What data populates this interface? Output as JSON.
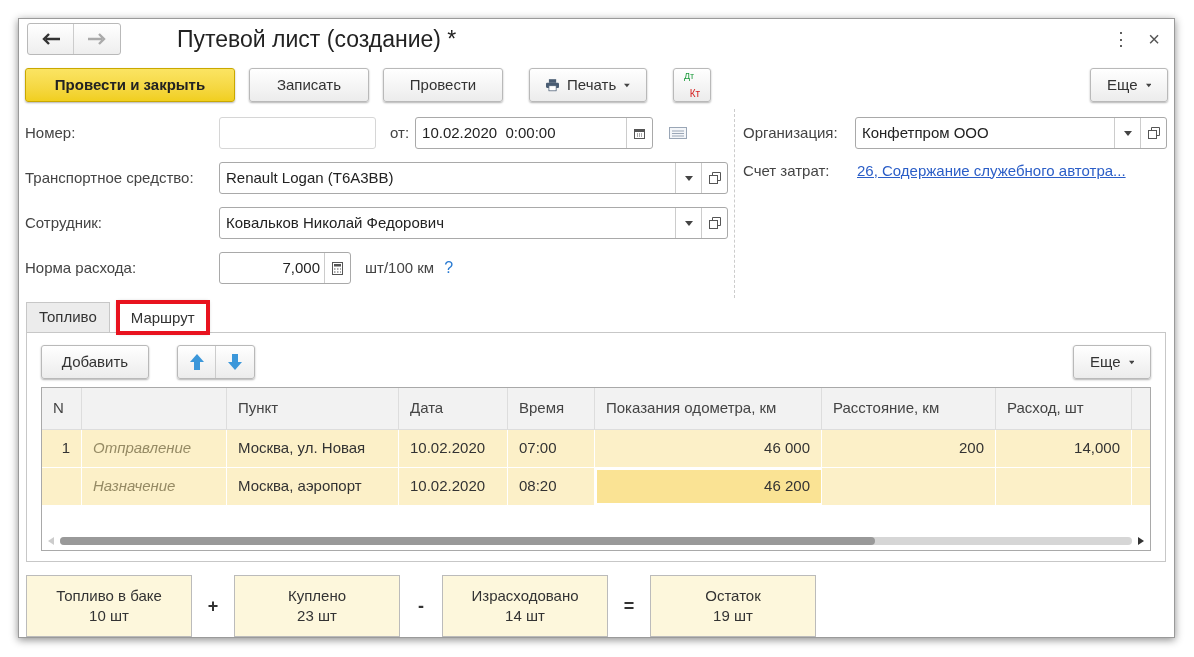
{
  "window": {
    "title": "Путевой лист (создание) *",
    "menu_icon": "⋮",
    "close": "×"
  },
  "toolbar": {
    "buttons": [
      {
        "kind": "primary",
        "label": "Провести и закрыть"
      },
      {
        "kind": "plain",
        "label": "Записать"
      },
      {
        "kind": "plain",
        "label": "Провести"
      },
      {
        "kind": "menu",
        "label": "Печать"
      },
      {
        "kind": "dtkt",
        "top": "Дт",
        "bottom": "Кт"
      }
    ],
    "more": "Еще"
  },
  "number": {
    "label": "Номер:"
  },
  "date": {
    "label": "от:",
    "value": "10.02.2020  0:00:00"
  },
  "vehicle": {
    "label": "Транспортное средство:",
    "value": "Renault Logan (Т6А3ВВ)"
  },
  "employee": {
    "label": "Сотрудник:",
    "value": "Ковальков Николай Федорович"
  },
  "norm": {
    "label": "Норма расхода:",
    "value": "7,000",
    "unit": "шт/100 км",
    "help": "?"
  },
  "organization": {
    "label": "Организация:",
    "value": "Конфетпром ООО"
  },
  "cost_account": {
    "label": "Счет затрат:",
    "value": "26, Содержание служебного автотра..."
  },
  "tabs": [
    {
      "label": "Топливо",
      "selected": false,
      "highlighted": false
    },
    {
      "label": "Маршрут",
      "selected": true,
      "highlighted": true
    }
  ],
  "table": {
    "add": "Добавить",
    "more": "Еще",
    "columns": [
      {
        "label": "N"
      },
      {},
      {
        "label": "Пункт"
      },
      {
        "label": "Дата"
      },
      {
        "label": "Время"
      },
      {
        "label": "Показания одометра, км"
      },
      {
        "label": "Расстояние, км"
      },
      {
        "label": "Расход, шт"
      }
    ],
    "rows": [
      {
        "n": "1",
        "type": "Отправление",
        "point": "Москва, ул. Новая",
        "date": "10.02.2020",
        "time": "07:00",
        "odometer": "46 000",
        "distance": "200",
        "consumption": "14,000",
        "selected": true,
        "odometer_focused": false
      },
      {
        "type": "Назначение",
        "point": "Москва, аэропорт",
        "date": "10.02.2020",
        "time": "08:20",
        "odometer": "46 200",
        "selected": true,
        "odometer_focused": true
      }
    ]
  },
  "summary": [
    {
      "kind": "box",
      "label": "Топливо в баке",
      "value": "10 шт"
    },
    {
      "kind": "op",
      "symbol": "+"
    },
    {
      "kind": "box",
      "label": "Куплено",
      "value": "23 шт"
    },
    {
      "kind": "op",
      "symbol": "-"
    },
    {
      "kind": "box",
      "label": "Израсходовано",
      "value": "14 шт"
    },
    {
      "kind": "op",
      "symbol": "="
    },
    {
      "kind": "box",
      "label": "Остаток",
      "value": "19 шт"
    }
  ]
}
